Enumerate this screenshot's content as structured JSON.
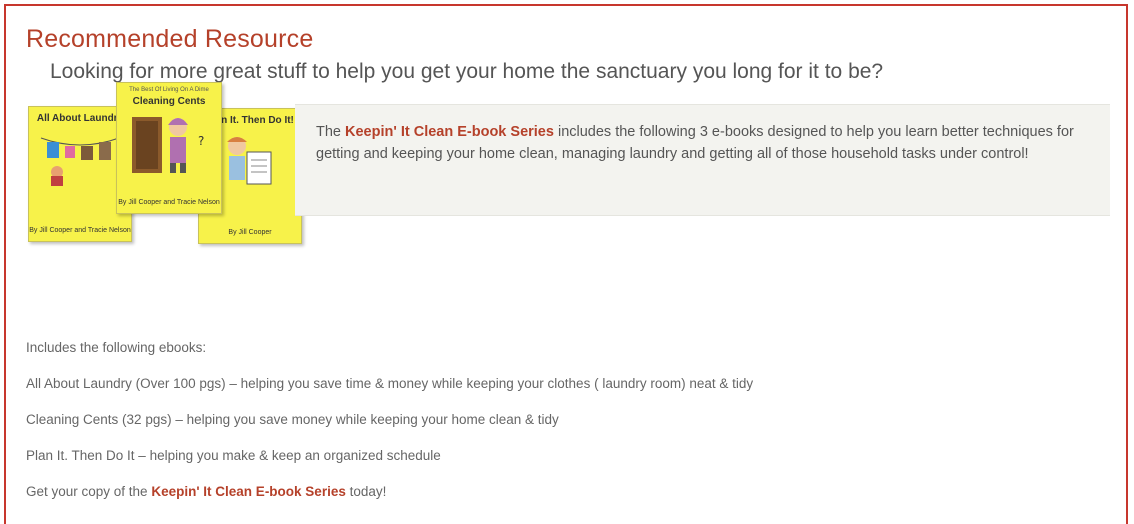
{
  "heading": "Recommended Resource",
  "subheading": "Looking for more great stuff to help you get your home the sanctuary you long for it to be?",
  "promo": {
    "pre": "The ",
    "series": "Keepin' It Clean E-book Series",
    "post": " includes the following 3 e-books designed to help you learn better techniques for getting and keeping your home clean, managing laundry and getting all of those household tasks under control!"
  },
  "books": [
    {
      "title": "All About Laundry",
      "author": "By Jill Cooper and Tracie Nelson"
    },
    {
      "title": "Cleaning Cents",
      "tagline": "The Best Of Living On A Dime",
      "author": "By Jill Cooper and Tracie Nelson"
    },
    {
      "title": "Plan It. Then Do It!",
      "author": "By Jill Cooper"
    }
  ],
  "list": {
    "intro": "Includes the following ebooks:",
    "items": [
      "All About Laundry (Over 100 pgs) – helping you save time & money while keeping your clothes ( laundry room) neat & tidy",
      "Cleaning Cents (32 pgs) – helping you save money while keeping your home clean & tidy",
      "Plan It. Then Do It – helping you make & keep an organized schedule"
    ],
    "cta_pre": "Get your copy of the ",
    "cta_series": "Keepin' It Clean E-book Series",
    "cta_post": " today!"
  },
  "colors": {
    "accent": "#b5412a",
    "border": "#c7362d",
    "book": "#f7f24a"
  }
}
